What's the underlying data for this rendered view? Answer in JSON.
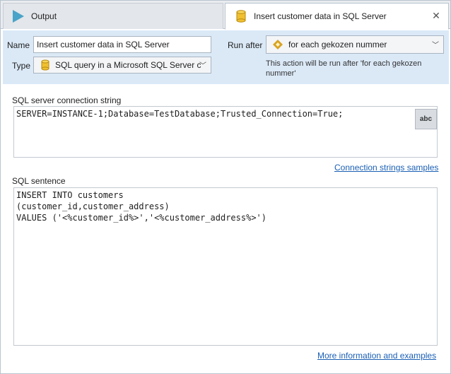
{
  "tabs": [
    {
      "label": "Output",
      "icon": "play-icon"
    },
    {
      "label": "Insert customer data in SQL Server",
      "icon": "database-icon",
      "active": true
    }
  ],
  "header": {
    "name_label": "Name",
    "name_value": "Insert customer data in SQL Server",
    "type_label": "Type",
    "type_value": "SQL query in a Microsoft SQL Server c",
    "run_after_label": "Run after",
    "run_after_value": "for each gekozen nummer",
    "run_after_hint": "This action will be run after 'for each gekozen nummer'"
  },
  "connection": {
    "label": "SQL server connection string",
    "value": "SERVER=INSTANCE-1;Database=TestDatabase;Trusted_Connection=True;",
    "abc_label": "abc",
    "samples_link": "Connection strings samples"
  },
  "sql": {
    "label": "SQL sentence",
    "lines": [
      "INSERT INTO customers",
      "(customer_id,customer_address)",
      "VALUES ('<%customer_id%>','<%customer_address%>')"
    ],
    "more_link": "More information and examples"
  },
  "colors": {
    "header_bg": "#dbe9f7",
    "link": "#1a5fb4",
    "play_icon": "#4aa3c8",
    "db_icon": "#f0c030",
    "loop_icon": "#d9a320"
  }
}
